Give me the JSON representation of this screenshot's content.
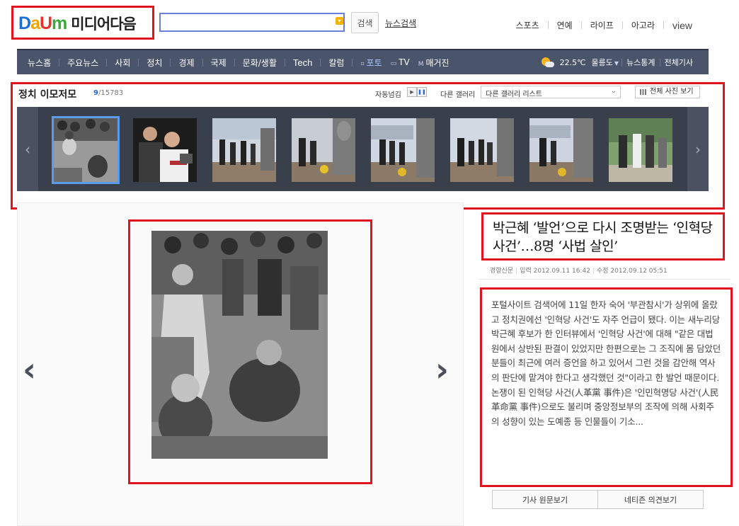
{
  "header": {
    "logo_brand": [
      "D",
      "a",
      "U",
      "m"
    ],
    "logo_service": "미디어다음",
    "search_button": "검색",
    "news_search": "뉴스검색",
    "top_nav": [
      "스포츠",
      "연예",
      "라이프",
      "아고라",
      "view"
    ]
  },
  "gnb": {
    "items": [
      "뉴스홈",
      "주요뉴스",
      "사회",
      "정치",
      "경제",
      "국제",
      "문화/생활",
      "Tech",
      "칼럼"
    ],
    "photo": "포토",
    "tv": "TV",
    "magazine": "매거진",
    "magazine_mark": "M",
    "temperature": "22.5℃",
    "region": "울릉도",
    "news_stats": "뉴스통계",
    "all_articles": "전체기사"
  },
  "gallery": {
    "title": "정치 이모저모",
    "current": "9",
    "total": "/15783",
    "auto_slide": "자동넘김",
    "other_gallery": "다른 갤러리",
    "select_value": "다른 갤러리 리스트",
    "view_all": "전체 사진 보기"
  },
  "article": {
    "title": "박근혜 ‘발언’으로 다시 조명받는 ‘인혁당 사건’…8명 ‘사법 살인’",
    "source": "경향신문",
    "input": "입력 2012.09.11 16:42",
    "modified": "수정 2012.09.12 05:51",
    "body": "포털사이트 검색어에 11일 한자 숙어 '부관참시'가 상위에 올랐고 정치권에선 '인혁당 사건'도 자주 언급이 됐다. 이는 새누리당 박근혜 후보가 한 인터뷰에서 '인혁당 사건'에 대해 \"같은 대법원에서 상반된 판결이 있었지만 한편으로는 그 조직에 몸 담았던 분들이 최근에 여러 증언을 하고 있어서 그런 것을 감안해 역사의 판단에 맡겨야 한다고 생각했던 것\"이라고 한 발언 때문이다. 논쟁이 된 인혁당 사건(人革黨 事件)은 '인민혁명당 사건'(人民革命黨 事件)으로도 불리며 중앙정보부의 조작에 의해 사회주의 성향이 있는 도예종 등 인물들이 기소...",
    "btn_original": "기사 원문보기",
    "btn_comments": "네티즌 의견보기"
  },
  "colors": {
    "highlight": "#e0131e",
    "gnb_bg": "#4a546a",
    "strip_bg": "#3a3f4c",
    "accent_blue": "#2b67d1"
  }
}
